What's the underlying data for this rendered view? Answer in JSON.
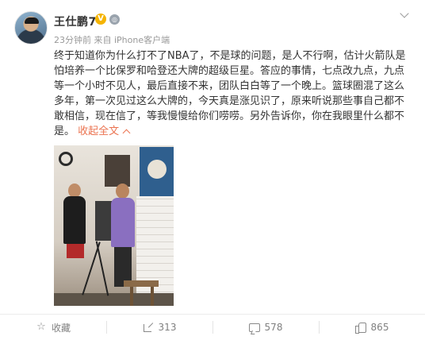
{
  "post": {
    "author": "王仕鹏7",
    "verified_badge": "V",
    "level_badge": "◎",
    "time": "23分钟前",
    "source": "来自 iPhone客户端",
    "body_lines": [
      "终于知道你为什么打不了NBA了，不是球的问题，是人不行啊，估计火箭队是",
      "怕培养一个比保罗和哈登还大牌的超级巨星。答应的事情，七点改九点，九点",
      "等一个小时不见人，最后直接不来，团队白白等了一个晚上。篮球圈混了这么",
      "多年，第一次见过这么大牌的，今天真是涨见识了，原来听说那些事自己都不",
      "敢相信，现在信了，等我慢慢给你们唠唠。另外告诉你，你在我眼里什么都不"
    ],
    "last_line": "是。",
    "collapse_label": "收起全文"
  },
  "actions": {
    "favorite_label": "收藏",
    "repost_count": "313",
    "comment_count": "578",
    "like_count": "865"
  },
  "icons": {
    "menu": "chevron-down-icon",
    "favorite": "star-icon",
    "repost": "share-icon",
    "comment": "comment-icon",
    "like": "thumbs-up-icon"
  },
  "colors": {
    "accent": "#eb7350",
    "verified": "#f5b400",
    "muted": "#999999"
  }
}
